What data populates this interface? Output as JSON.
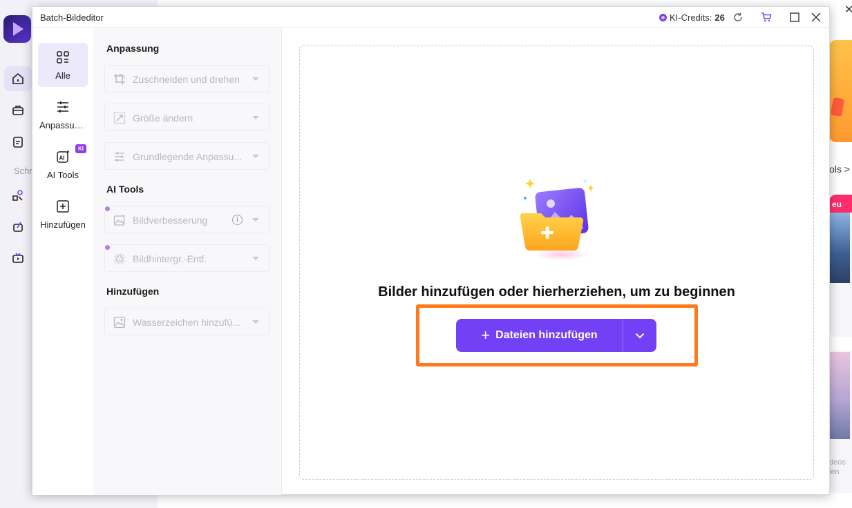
{
  "background": {
    "rail_label": "Schr",
    "right_text_tools": "ols >",
    "right_badge": "eu",
    "right_text_small_1": "deos",
    "right_text_small_2": "len",
    "close_glyph": "✕"
  },
  "dialog": {
    "title": "Batch-Bildeditor",
    "credits_label": "KI-Credits:",
    "credits_value": "26"
  },
  "rail": {
    "items": [
      {
        "label": "Alle",
        "icon": "grid-icon"
      },
      {
        "label": "Anpassungen",
        "icon": "sliders-icon"
      },
      {
        "label": "AI Tools",
        "icon": "ai-icon",
        "badge": "KI"
      },
      {
        "label": "Hinzufügen",
        "icon": "plus-square-icon"
      }
    ]
  },
  "panel": {
    "sections": [
      {
        "title": "Anpassung"
      },
      {
        "title": "AI Tools"
      },
      {
        "title": "Hinzufügen"
      }
    ],
    "tools": [
      {
        "label": "Zuschneiden und drehen",
        "icon": "crop-rotate-icon"
      },
      {
        "label": "Größe ändern",
        "icon": "resize-icon"
      },
      {
        "label": "Grundlegende Anpassu...",
        "icon": "sliders-icon"
      },
      {
        "label": "Bildverbesserung",
        "icon": "enhance-icon"
      },
      {
        "label": "Bildhintergr.-Entf.",
        "icon": "background-remove-icon"
      },
      {
        "label": "Wasserzeichen hinzufü...",
        "icon": "watermark-icon"
      }
    ]
  },
  "dropzone": {
    "heading": "Bilder hinzufügen oder hierherziehen, um zu beginnen",
    "add_button_label": "Dateien hinzufügen",
    "add_button_plus": "+",
    "info_glyph": "i"
  },
  "colors": {
    "accent": "#7440f5",
    "highlight": "#ff7a1c"
  }
}
